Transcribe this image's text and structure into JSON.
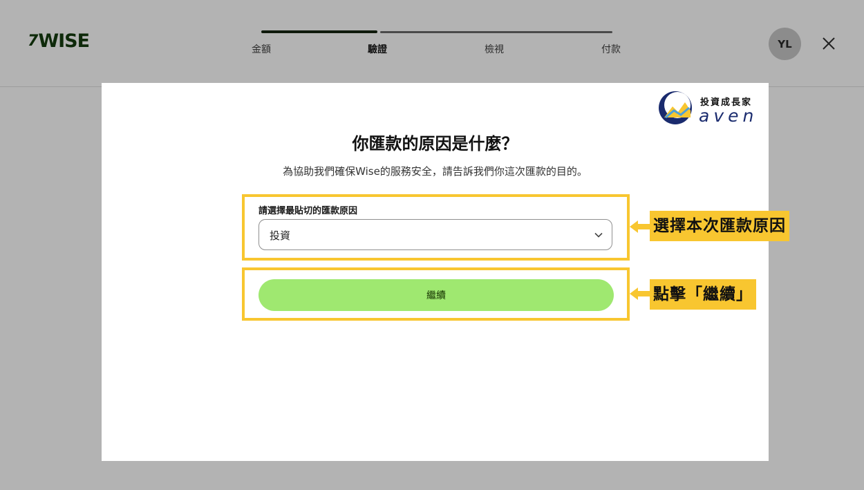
{
  "header": {
    "logo_mark": "7",
    "logo_text": "WISE",
    "steps": [
      {
        "label": "金額",
        "active": false
      },
      {
        "label": "驗證",
        "active": true
      },
      {
        "label": "檢視",
        "active": false
      },
      {
        "label": "付款",
        "active": false
      }
    ],
    "avatar_initials": "YL",
    "close_icon": "close-icon"
  },
  "watermark": {
    "tagline": "投資成長家",
    "name": "aven"
  },
  "form": {
    "title": "你匯款的原因是什麼？",
    "subtitle": "為協助我們確保Wise的服務安全，請告訴我們你這次匯款的目的。",
    "reason_label": "請選擇最貼切的匯款原因",
    "reason_value": "投資",
    "continue_label": "繼續"
  },
  "annotations": {
    "select_callout": "選擇本次匯款原因",
    "button_callout": "點擊「繼續」",
    "highlight_color": "#f8c630"
  },
  "colors": {
    "brand_green": "#9fe870",
    "overlay_gray": "#b3b3b3"
  }
}
